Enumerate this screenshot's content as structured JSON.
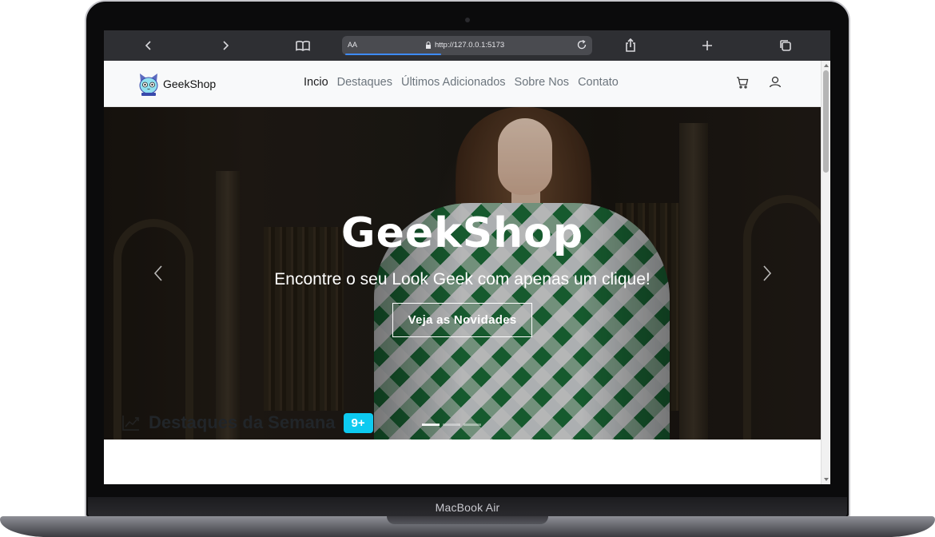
{
  "device": {
    "label": "MacBook Air"
  },
  "browser": {
    "reader_label": "AA",
    "url": "http://127.0.0.1:5173",
    "buttons": [
      "back",
      "forward",
      "bookmarks",
      "share",
      "new-tab",
      "tabs"
    ]
  },
  "navbar": {
    "brand": "GeekShop",
    "links": [
      {
        "label": "Incio",
        "active": true
      },
      {
        "label": "Destaques",
        "active": false
      },
      {
        "label": "Últimos Adicionados",
        "active": false
      },
      {
        "label": "Sobre Nos",
        "active": false
      },
      {
        "label": "Contato",
        "active": false
      }
    ],
    "icons": [
      "cart-icon",
      "user-icon"
    ]
  },
  "hero": {
    "title": "GeekShop",
    "subtitle": "Encontre o seu Look Geek com apenas um clique!",
    "button": "Veja as Novidades",
    "slides": 3,
    "active_slide": 0
  },
  "section": {
    "title": "Destaques da Semana",
    "badge": "9+"
  },
  "colors": {
    "badge": "#0dcaf0",
    "toolbar": "#2e2f33",
    "navbar_bg": "#f8f9fa"
  }
}
